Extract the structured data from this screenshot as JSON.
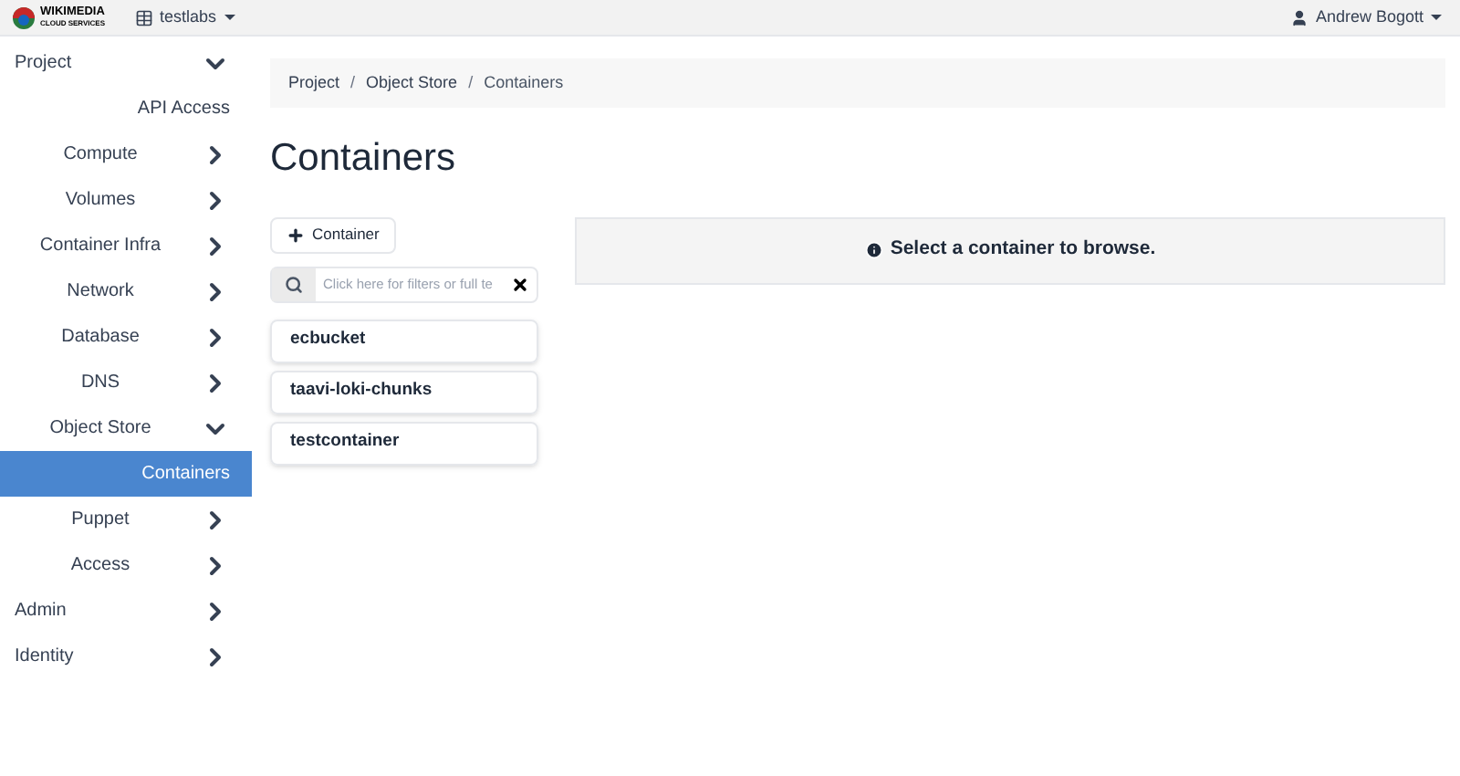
{
  "header": {
    "logo": {
      "line1": "WIKIMEDIA",
      "line2": "CLOUD SERVICES"
    },
    "project_menu": "testlabs",
    "user_menu": "Andrew Bogott"
  },
  "sidebar": {
    "items": [
      {
        "label": "Project",
        "expanded": true,
        "selected": false,
        "children": [
          {
            "label": "API Access",
            "selected": false
          },
          {
            "label": "Compute",
            "expanded": false,
            "selected": false
          },
          {
            "label": "Volumes",
            "expanded": false,
            "selected": false
          },
          {
            "label": "Container Infra",
            "expanded": false,
            "selected": false
          },
          {
            "label": "Network",
            "expanded": false,
            "selected": false
          },
          {
            "label": "Database",
            "expanded": false,
            "selected": false
          },
          {
            "label": "DNS",
            "expanded": false,
            "selected": false
          },
          {
            "label": "Object Store",
            "expanded": true,
            "selected": false,
            "children": [
              {
                "label": "Containers",
                "selected": true
              }
            ]
          },
          {
            "label": "Puppet",
            "expanded": false,
            "selected": false
          },
          {
            "label": "Access",
            "expanded": false,
            "selected": false
          }
        ]
      },
      {
        "label": "Admin",
        "expanded": false,
        "selected": false
      },
      {
        "label": "Identity",
        "expanded": false,
        "selected": false
      }
    ]
  },
  "breadcrumb": {
    "separator": "/",
    "items": [
      "Project",
      "Object Store",
      "Containers"
    ]
  },
  "title": "Containers",
  "add_button": "Container",
  "filter": {
    "placeholder": "Click here for filters or full te"
  },
  "containers": [
    "ecbucket",
    "taavi-loki-chunks",
    "testcontainer"
  ],
  "message": "Select a container to browse."
}
